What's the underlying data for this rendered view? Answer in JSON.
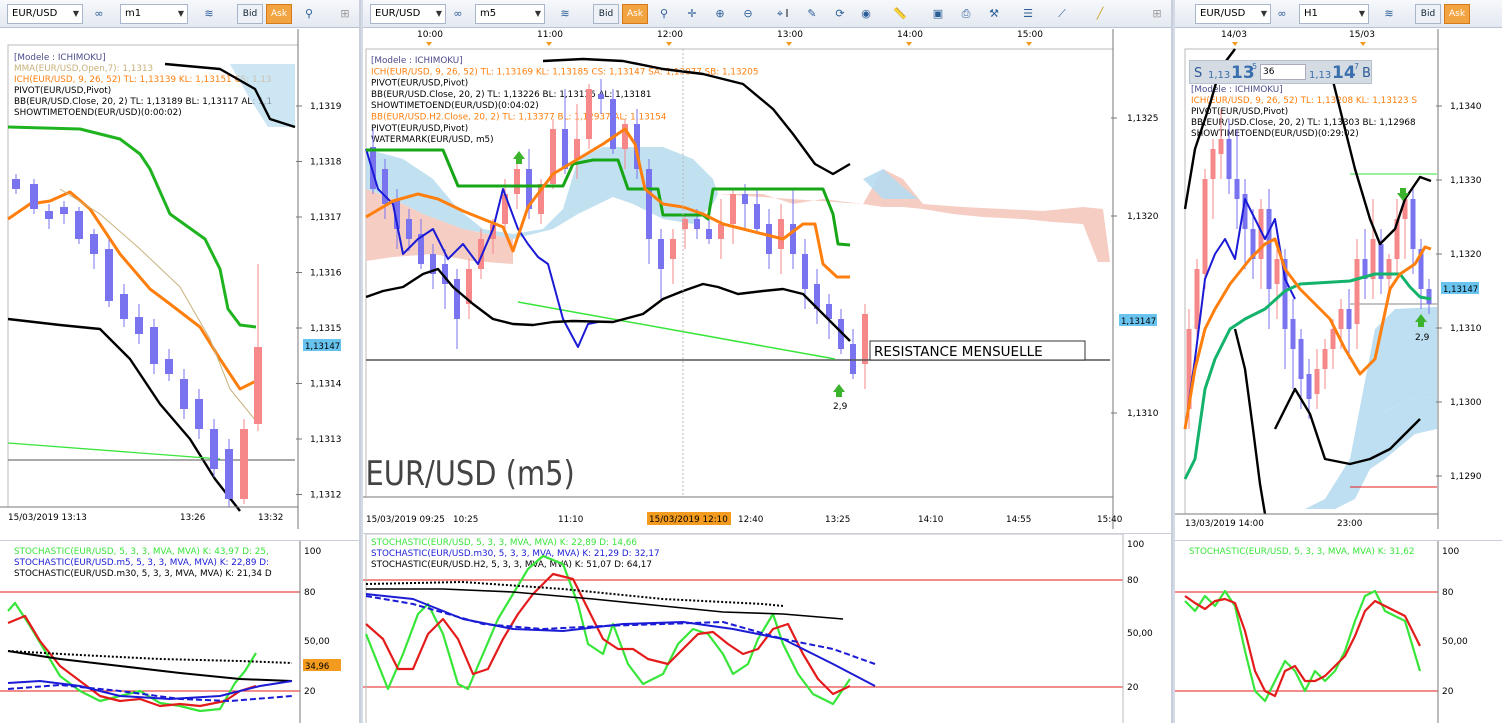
{
  "colors": {
    "bull": "#7a73f0",
    "bear": "#f6888a",
    "ichimoku_fast": "#ff7f0e",
    "ichimoku_slow": "#1fb41f",
    "black": "#000000",
    "blue": "#1b1bd6",
    "tan": "#c8b07a",
    "cloud_blue": "#b6dcef",
    "cloud_red": "#f4c8bd",
    "price_tag": "#69c3ef",
    "stoch_green": "#38e63a",
    "stoch_red": "#e41b1b",
    "orange_tag": "#f29b1e"
  },
  "toolbar": {
    "symbol_1": "EUR/USD",
    "timeframe_1": "m1",
    "symbol_2": "EUR/USD",
    "timeframe_2": "m5",
    "symbol_3": "EUR/USD",
    "timeframe_3": "H1",
    "bid": "Bid",
    "ask": "Ask"
  },
  "panel1": {
    "legend": [
      "[Modele : ICHIMOKU]",
      "MMA(EUR/USD,Open,7): 1,1313",
      "ICH(EUR/USD, 9, 26, 52)  TL: 1,13139   KL: 1,13151   CS: 1,13",
      "PIVOT(EUR/USD,Pivot)",
      "BB(EUR/USD.Close, 20, 2)  TL: 1,13189  BL: 1,13117  AL: 1,1",
      "SHOWTIMETOEND(EUR/USD)(0:00:02)"
    ],
    "y_axis": [
      "1,1319",
      "1,1318",
      "1,1317",
      "1,1316",
      "1,1315",
      "1,1314",
      "1,1313",
      "1,1312"
    ],
    "price_tag": "1,13147",
    "x_axis": [
      "15/03/2019 13:13",
      "13:26",
      "13:32"
    ],
    "stoch_legend": [
      "STOCHASTIC(EUR/USD, 5, 3, 3, MVA, MVA)  K: 43,97  D: 25,",
      "STOCHASTIC(EUR/USD.m5, 5, 3, 3, MVA, MVA)  K: 22,89  D:",
      "STOCHASTIC(EUR/USD.m30, 5, 3, 3, MVA, MVA)  K: 21,34  D"
    ],
    "stoch_axis": [
      "100",
      "80",
      "50,00",
      "20"
    ],
    "stoch_tag": "34,96"
  },
  "panel2": {
    "time_labels": [
      "10:00",
      "11:00",
      "12:00",
      "13:00",
      "14:00",
      "15:00"
    ],
    "legend": [
      "[Modele : ICHIMOKU]",
      "ICH(EUR/USD, 9, 26, 52)  TL: 1,13169   KL: 1,13185   CS: 1,13147   SA: 1,13077   SB: 1,13205",
      "PIVOT(EUR/USD,Pivot)",
      "BB(EUR/USD.Close, 20, 2)  TL: 1,13226  BL: 1,13136  AL: 1,13181",
      "SHOWTIMETOEND(EUR/USD)(0:04:02)",
      "BB(EUR/USD.H2.Close, 20, 2)  TL: 1,13377  BL: 1,12937  AL: 1,13154",
      "PIVOT(EUR/USD,Pivot)",
      "WATERMARK(EUR/USD, m5)"
    ],
    "y_axis": [
      "1,1325",
      "1,1320",
      "1,1310"
    ],
    "price_tag": "1,13147",
    "watermark": "EUR/USD (m5)",
    "resistance_label": "RESISTANCE MENSUELLE",
    "arrow_value": "2,9",
    "x_axis": [
      "15/03/2019 09:25",
      "10:25",
      "11:10",
      "15/03/2019 12:10",
      "12:40",
      "13:25",
      "14:10",
      "14:55",
      "15:40"
    ],
    "stoch_legend": [
      "STOCHASTIC(EUR/USD, 5, 3, 3, MVA, MVA)  K: 22,89  D: 14,66",
      "STOCHASTIC(EUR/USD.m30, 5, 3, 3, MVA, MVA)  K: 21,29  D: 32,17",
      "STOCHASTIC(EUR/USD.H2, 5, 3, 3, MVA, MVA)  K: 51,07  D: 64,17"
    ],
    "stoch_axis": [
      "100",
      "80",
      "50,00",
      "20"
    ]
  },
  "panel3": {
    "date_labels": [
      "14/03",
      "15/03"
    ],
    "quote": {
      "sell_letter": "S",
      "sell_small": "1,13",
      "sell_big": "13",
      "sell_sup": "5",
      "spread": "36",
      "buy_small": "1,13",
      "buy_big": "14",
      "buy_sup": "7",
      "buy_letter": "B"
    },
    "legend": [
      "[Modele : ICHIMOKU]",
      "ICH(EUR/USD, 9, 26, 52)  TL: 1,13208   KL: 1,13123   S",
      "PIVOT(EUR/USD,Pivot)",
      "BB(EUR/USD.Close, 20, 2)  TL: 1,13303  BL: 1,12968",
      "SHOWTIMETOEND(EUR/USD)(0:29:02)"
    ],
    "y_axis": [
      "1,1340",
      "1,1330",
      "1,1320",
      "1,1310",
      "1,1300",
      "1,1290"
    ],
    "price_tag": "1,13147",
    "arrow_value": "2,9",
    "x_axis": [
      "13/03/2019 14:00",
      "23:00"
    ],
    "stoch_legend": [
      "STOCHASTIC(EUR/USD, 5, 3, 3, MVA, MVA)  K: 31,62"
    ],
    "stoch_axis": [
      "100",
      "80",
      "50,00",
      "20"
    ]
  }
}
